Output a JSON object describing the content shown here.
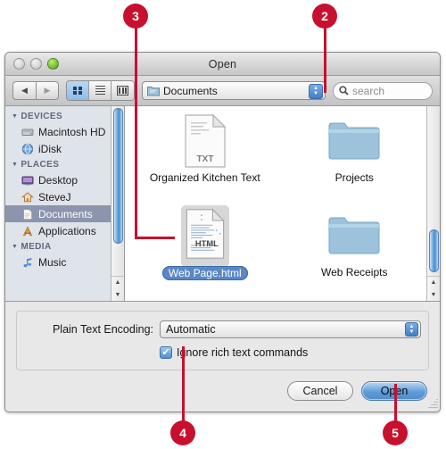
{
  "window": {
    "title": "Open",
    "traffic_lights": [
      "close-disabled",
      "minimize-disabled",
      "zoom-green"
    ]
  },
  "toolbar": {
    "back_label": "◀",
    "forward_label": "▶",
    "view_icon_label": "icon-view",
    "view_list_label": "list-view",
    "view_column_label": "column-view",
    "path_popup_value": "Documents",
    "search_placeholder": "search",
    "search_value": ""
  },
  "sidebar": {
    "sections": [
      {
        "label": "DEVICES",
        "items": [
          {
            "label": "Macintosh HD",
            "icon": "hard-disk-icon",
            "selected": false
          },
          {
            "label": "iDisk",
            "icon": "idisk-globe-icon",
            "selected": false
          }
        ]
      },
      {
        "label": "PLACES",
        "items": [
          {
            "label": "Desktop",
            "icon": "desktop-icon",
            "selected": false
          },
          {
            "label": "SteveJ",
            "icon": "home-icon",
            "selected": false
          },
          {
            "label": "Documents",
            "icon": "documents-folder-icon",
            "selected": true
          },
          {
            "label": "Applications",
            "icon": "applications-icon",
            "selected": false
          }
        ]
      },
      {
        "label": "MEDIA",
        "items": [
          {
            "label": "Music",
            "icon": "music-note-icon",
            "selected": false
          }
        ]
      }
    ]
  },
  "files": [
    {
      "name": "Organized Kitchen Text",
      "kind": "text-file",
      "badge": "TXT",
      "selected": false
    },
    {
      "name": "Projects",
      "kind": "folder",
      "badge": "",
      "selected": false
    },
    {
      "name": "Web Page.html",
      "kind": "html-file",
      "badge": "HTML",
      "selected": true
    },
    {
      "name": "Web Receipts",
      "kind": "folder",
      "badge": "",
      "selected": false
    }
  ],
  "accessory": {
    "encoding_label": "Plain Text Encoding:",
    "encoding_value": "Automatic",
    "ignore_rich_text_label": "Ignore rich text commands",
    "ignore_rich_text_checked": true,
    "checkmark": "✔"
  },
  "footer": {
    "cancel_label": "Cancel",
    "open_label": "Open"
  },
  "callouts": [
    {
      "number": "3"
    },
    {
      "number": "2"
    },
    {
      "number": "4"
    },
    {
      "number": "5"
    }
  ],
  "colors": {
    "callout_red": "#c8102e",
    "selection_blue": "#5a87c6",
    "sidebar_selection": "#8c94ae",
    "folder_blue": "#9cc2dc"
  }
}
